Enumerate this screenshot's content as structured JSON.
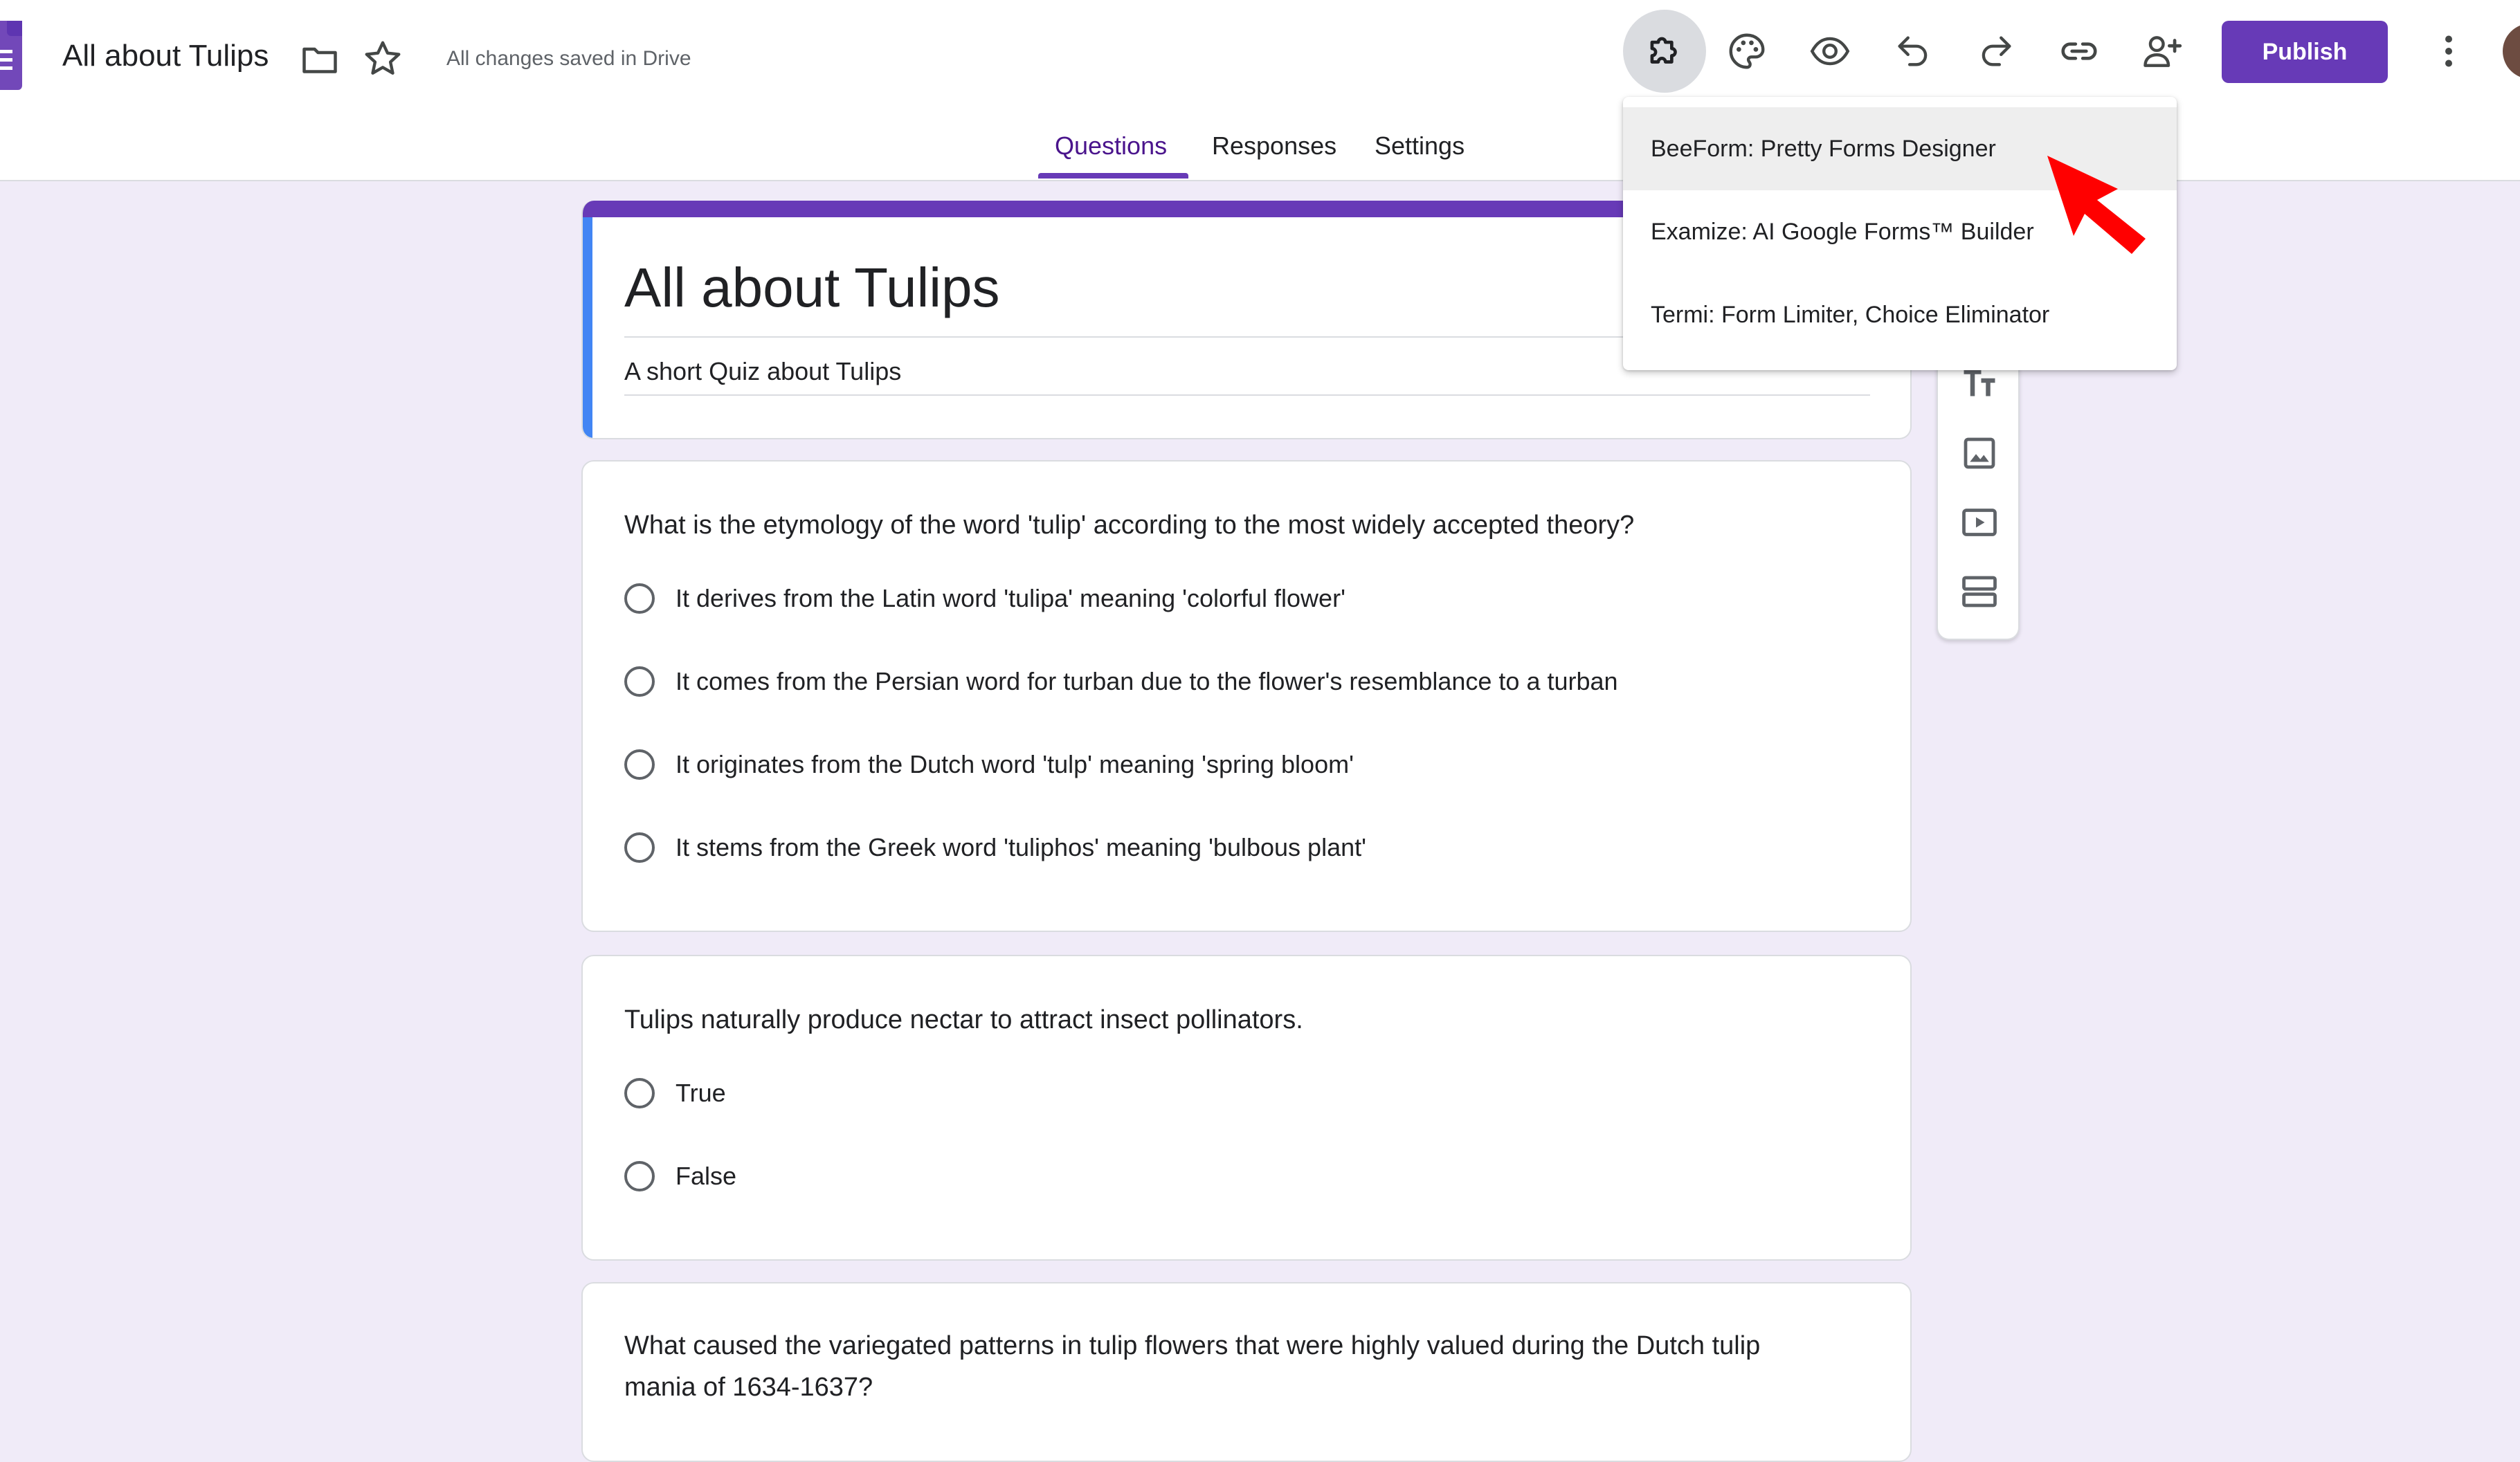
{
  "header": {
    "doc_title": "All about Tulips",
    "save_status": "All changes saved in Drive",
    "publish_label": "Publish",
    "toolbar_icons": [
      "add-ons-icon",
      "palette-icon",
      "preview-eye-icon",
      "undo-icon",
      "redo-icon",
      "link-icon",
      "add-collaborator-icon",
      "more-vert-icon"
    ],
    "brand_color": "#673ab7"
  },
  "tabs": [
    {
      "label": "Questions",
      "active": true
    },
    {
      "label": "Responses",
      "active": false
    },
    {
      "label": "Settings",
      "active": false
    }
  ],
  "form": {
    "title": "All about Tulips",
    "description": "A short Quiz about Tulips"
  },
  "questions": [
    {
      "text": "What is the etymology of the word 'tulip' according to the most widely accepted theory?",
      "options": [
        "It derives from the Latin word 'tulipa' meaning 'colorful flower'",
        "It comes from the Persian word for turban due to the flower's resemblance to a turban",
        "It originates from the Dutch word 'tulp' meaning 'spring bloom'",
        "It stems from the Greek word 'tuliphos' meaning 'bulbous plant'"
      ]
    },
    {
      "text": "Tulips naturally produce nectar to attract insect pollinators.",
      "options": [
        "True",
        "False"
      ]
    },
    {
      "text_line1": "What caused the variegated patterns in tulip flowers that were highly valued during the Dutch tulip",
      "text_line2": "mania of 1634-1637?"
    }
  ],
  "addons_menu": {
    "items": [
      "BeeForm: Pretty Forms Designer",
      "Examize: AI Google Forms™ Builder",
      "Termi: Form Limiter, Choice Eliminator"
    ],
    "hovered_index": 0
  },
  "sidebar_tools": [
    "add-title-icon",
    "add-image-icon",
    "add-video-icon",
    "add-section-icon"
  ],
  "annotation": {
    "color": "#ff0000",
    "type": "pointer-arrow"
  }
}
